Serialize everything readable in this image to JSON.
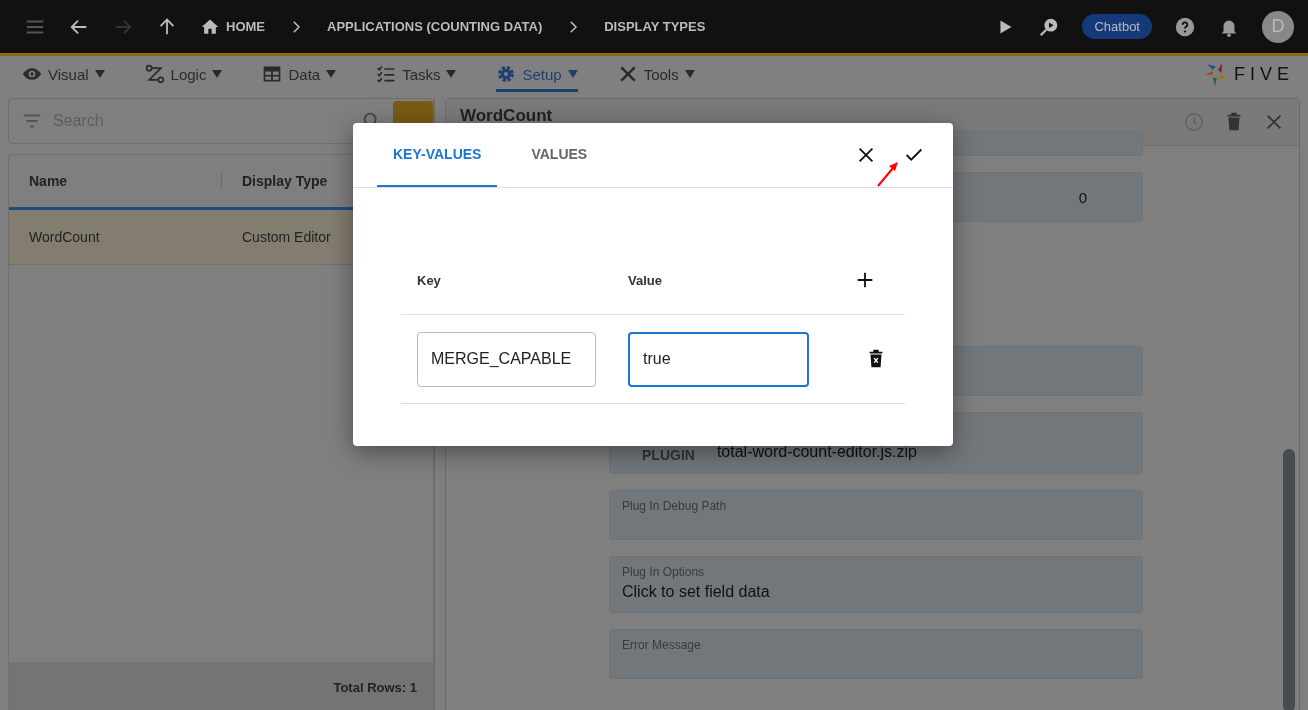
{
  "top_bar": {
    "breadcrumbs": [
      {
        "label": "HOME"
      },
      {
        "label": "APPLICATIONS (COUNTING DATA)"
      },
      {
        "label": "DISPLAY TYPES"
      }
    ],
    "chatbot": "Chatbot",
    "avatar": "D"
  },
  "menu": [
    {
      "label": "Visual",
      "selected": false
    },
    {
      "label": "Logic",
      "selected": false
    },
    {
      "label": "Data",
      "selected": false
    },
    {
      "label": "Tasks",
      "selected": false
    },
    {
      "label": "Setup",
      "selected": true
    },
    {
      "label": "Tools",
      "selected": false
    }
  ],
  "logo": "FIVE",
  "list_panel": {
    "search": {
      "placeholder": "Search"
    },
    "columns": [
      "Name",
      "Display Type"
    ],
    "rows": [
      {
        "cells": [
          "WordCount",
          "Custom Editor"
        ],
        "selected": true
      }
    ],
    "footer": "Total Rows: 1"
  },
  "detail": {
    "title": "WordCount",
    "fields": [
      {
        "kind": "blank"
      },
      {
        "kind": "number",
        "value": "0"
      },
      {
        "kind": "blank"
      },
      {
        "kind": "file",
        "label": "PLUGIN",
        "value": "total-word-count-editor.js.zip"
      },
      {
        "kind": "labeled",
        "label": "Plug In Debug Path"
      },
      {
        "kind": "labeled",
        "label": "Plug In Options",
        "value": "Click to set field data"
      },
      {
        "kind": "labeled",
        "label": "Error Message"
      }
    ]
  },
  "dialog": {
    "tabs": [
      {
        "label": "KEY-VALUES",
        "selected": true
      },
      {
        "label": "VALUES",
        "selected": false
      }
    ],
    "columns": [
      "Key",
      "Value"
    ],
    "rows": [
      {
        "key": "MERGE_CAPABLE",
        "value": "true",
        "focused": true
      }
    ]
  }
}
